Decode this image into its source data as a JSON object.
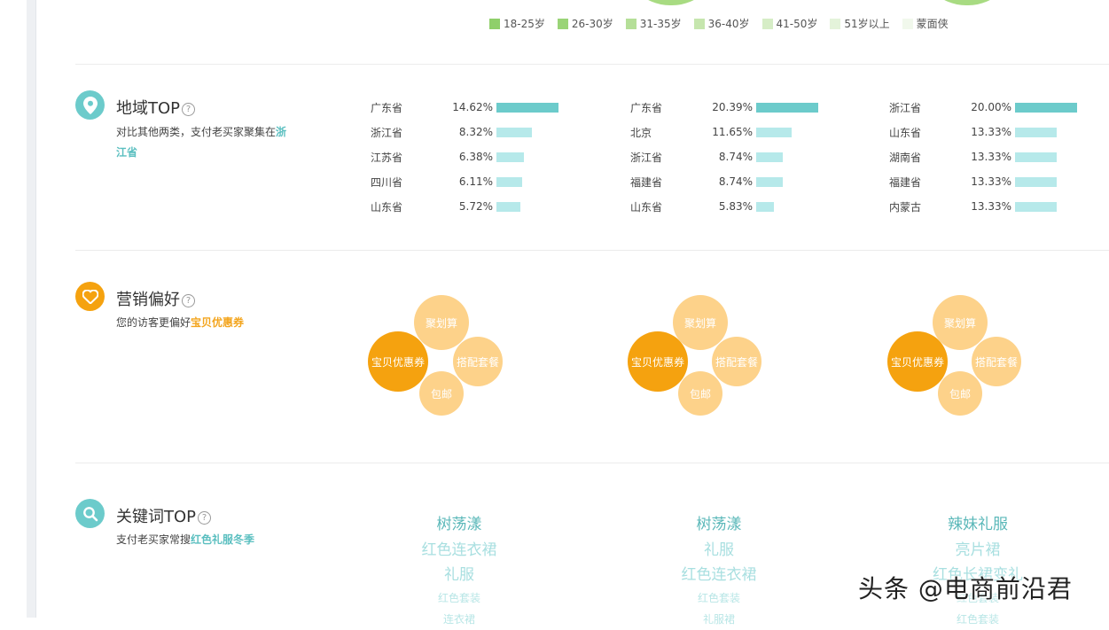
{
  "age_legend": [
    {
      "label": "18-25岁",
      "color": "#8fcf6a"
    },
    {
      "label": "26-30岁",
      "color": "#9ad477"
    },
    {
      "label": "31-35岁",
      "color": "#b5df98"
    },
    {
      "label": "36-40岁",
      "color": "#c6e6ae"
    },
    {
      "label": "41-50岁",
      "color": "#d6edc6"
    },
    {
      "label": "51岁以上",
      "color": "#e4f3da"
    },
    {
      "label": "蒙面侠",
      "color": "#f1f8ec"
    }
  ],
  "region": {
    "title": "地域TOP",
    "help": "?",
    "desc_prefix": "对比其他两类，支付老买家聚集在",
    "desc_highlight": "浙江省",
    "columns": [
      {
        "rows": [
          {
            "name": "广东省",
            "pct_text": "14.62%",
            "value": 14.62
          },
          {
            "name": "浙江省",
            "pct_text": "8.32%",
            "value": 8.32
          },
          {
            "name": "江苏省",
            "pct_text": "6.38%",
            "value": 6.38
          },
          {
            "name": "四川省",
            "pct_text": "6.11%",
            "value": 6.11
          },
          {
            "name": "山东省",
            "pct_text": "5.72%",
            "value": 5.72
          }
        ]
      },
      {
        "rows": [
          {
            "name": "广东省",
            "pct_text": "20.39%",
            "value": 20.39
          },
          {
            "name": "北京",
            "pct_text": "11.65%",
            "value": 11.65
          },
          {
            "name": "浙江省",
            "pct_text": "8.74%",
            "value": 8.74
          },
          {
            "name": "福建省",
            "pct_text": "8.74%",
            "value": 8.74
          },
          {
            "name": "山东省",
            "pct_text": "5.83%",
            "value": 5.83
          }
        ]
      },
      {
        "rows": [
          {
            "name": "浙江省",
            "pct_text": "20.00%",
            "value": 20.0
          },
          {
            "name": "山东省",
            "pct_text": "13.33%",
            "value": 13.33
          },
          {
            "name": "湖南省",
            "pct_text": "13.33%",
            "value": 13.33
          },
          {
            "name": "福建省",
            "pct_text": "13.33%",
            "value": 13.33
          },
          {
            "name": "内蒙古",
            "pct_text": "13.33%",
            "value": 13.33
          }
        ]
      }
    ]
  },
  "marketing": {
    "title": "营销偏好",
    "help": "?",
    "desc_prefix": "您的访客更偏好",
    "desc_highlight": "宝贝优惠券",
    "bubbles": {
      "main": "宝贝优惠券",
      "top": "聚划算",
      "right": "搭配套餐",
      "bottom": "包邮"
    }
  },
  "keywords": {
    "title": "关键词TOP",
    "help": "?",
    "desc_prefix": "支付老买家常搜",
    "desc_highlight": "红色礼服冬季",
    "columns": [
      [
        "树荡漾",
        "红色连衣裙",
        "礼服",
        "红色套装",
        "连衣裙"
      ],
      [
        "树荡漾",
        "礼服",
        "红色连衣裙",
        "红色套装",
        "礼服裙"
      ],
      [
        "辣妹礼服",
        "亮片裙",
        "红色长裙变礼",
        "红色套装",
        "红色套装"
      ]
    ]
  },
  "watermark": "头条 @电商前沿君",
  "icons": {
    "region": "location-pin-icon",
    "marketing": "heart-icon",
    "keywords": "search-icon",
    "help": "question-circle-icon"
  },
  "colors": {
    "teal": "#6ccbcb",
    "teal_light": "#b6e9ea",
    "orange": "#f5a20f",
    "orange_light": "#fdd28a"
  }
}
